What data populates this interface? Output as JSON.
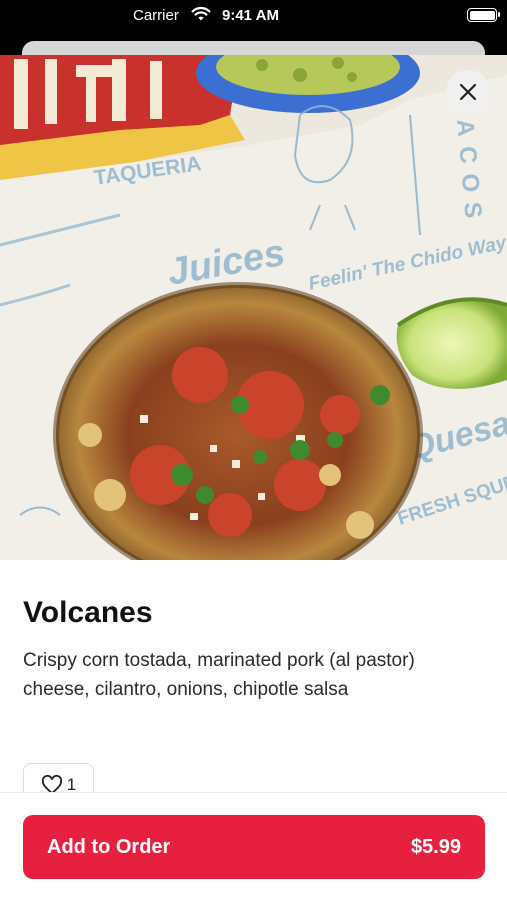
{
  "status_bar": {
    "carrier": "Carrier",
    "time": "9:41 AM"
  },
  "item": {
    "name": "Volcanes",
    "description": "Crispy corn tostada, marinated pork (al pastor) cheese, cilantro, onions, chipotle salsa",
    "photo_wrapper_text": [
      "TAQUERIA",
      "TACOS",
      "Juices",
      "FRESH SQUEEZED",
      "Feelin' The Chido Way",
      "Quesadi"
    ],
    "like_count": "1"
  },
  "order_button": {
    "label": "Add to Order",
    "price": "$5.99"
  },
  "colors": {
    "accent": "#e8203f",
    "wrapper_print": "#8fb4cc"
  },
  "icons": [
    "wifi-icon",
    "battery-icon",
    "close-icon",
    "heart-icon"
  ]
}
